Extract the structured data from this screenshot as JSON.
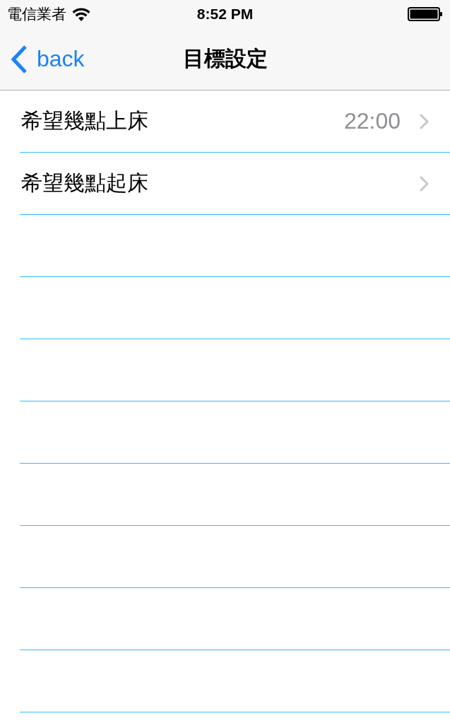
{
  "status_bar": {
    "carrier": "電信業者",
    "time": "8:52 PM"
  },
  "nav_bar": {
    "back": "back",
    "title": "目標設定"
  },
  "rows": [
    {
      "label": "希望幾點上床",
      "value": "22:00"
    },
    {
      "label": "希望幾點起床"
    }
  ]
}
